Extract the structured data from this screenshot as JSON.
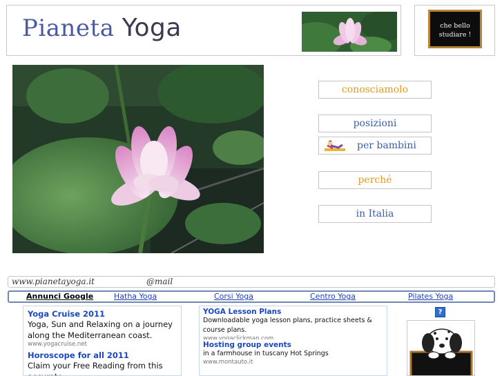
{
  "header": {
    "title_part1": "Pianeta",
    "title_part2": "Yoga",
    "board_line1": "che bello",
    "board_line2": "studiare !"
  },
  "nav": {
    "items": [
      {
        "label": "conosciamolo",
        "color": "#e09a1e"
      },
      {
        "label": "posizioni",
        "color": "#3b5fa8"
      },
      {
        "label": "per bambini",
        "color": "#3b5fa8"
      },
      {
        "label": "perché",
        "color": "#e09a1e"
      },
      {
        "label": "in Italia",
        "color": "#3b5fa8"
      }
    ]
  },
  "footer_bar": {
    "url": "www.pianetayoga.it",
    "mail": "@mail"
  },
  "ad_links": {
    "label": "Annunci Google",
    "links": [
      "Hatha Yoga",
      "Corsi Yoga",
      "Centro Yoga",
      "Pilates Yoga"
    ]
  },
  "ads_left": [
    {
      "title": "Yoga Cruise 2011",
      "body": "Yoga, Sun and Relaxing on a journey along the Mediterranean coast.",
      "url": "www.yogacruise.net"
    },
    {
      "title": "Horoscope for all 2011",
      "body": "Claim your Free Reading from this accurate",
      "url": ""
    }
  ],
  "ads_middle": [
    {
      "title": "YOGA Lesson Plans",
      "body": "Downloadable yoga lesson plans, practice sheets & course plans.",
      "url": "www.yogaclickman.com"
    },
    {
      "title": "Hosting group events",
      "body": "in a farmhouse in tuscany Hot Springs",
      "url": "www.montauto.it"
    }
  ],
  "help_icon": "?",
  "colors": {
    "accent_orange": "#e09a1e",
    "accent_blue": "#3b5fa8",
    "ad_link_blue": "#1a48c0"
  }
}
